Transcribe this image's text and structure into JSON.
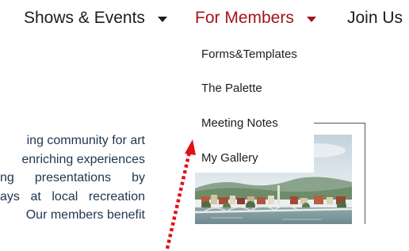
{
  "nav": {
    "items": [
      {
        "label": "Shows & Events"
      },
      {
        "label": "For Members"
      },
      {
        "label": "Join Us"
      }
    ]
  },
  "dropdown": {
    "items": [
      {
        "label": "Forms&Templates"
      },
      {
        "label": "The Palette"
      },
      {
        "label": "Meeting Notes"
      },
      {
        "label": "My Gallery"
      }
    ]
  },
  "intro": {
    "lines": [
      "ing community for art",
      "enriching experiences",
      [
        "ng",
        "presentations",
        "by"
      ],
      [
        "ays",
        "at",
        "local",
        "recreation"
      ],
      "Our members benefit"
    ]
  },
  "colors": {
    "nav_text": "#1d1d1d",
    "nav_active": "#a3141c",
    "body_text": "#1f3550",
    "annotation_arrow": "#e0101a"
  },
  "icons": {
    "dropdown_caret": "caret-down-icon",
    "annotation": "red-dotted-arrow-icon"
  }
}
